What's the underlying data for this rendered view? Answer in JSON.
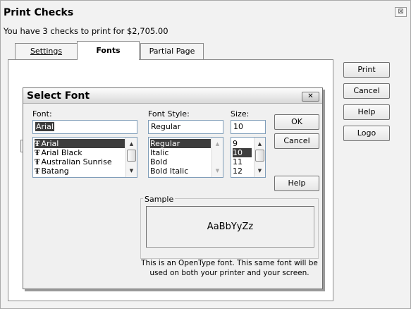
{
  "window": {
    "title": "Print Checks",
    "close_glyph": "⊠",
    "summary": "You have 3 checks to print for $2,705.00"
  },
  "tabs": [
    {
      "label": "Settings"
    },
    {
      "label": "Fonts"
    },
    {
      "label": "Partial Page"
    }
  ],
  "side_buttons": {
    "print": "Print",
    "cancel": "Cancel",
    "help": "Help",
    "logo": "Logo"
  },
  "select_font": {
    "title": "Select Font",
    "close_glyph": "✕",
    "font": {
      "label": "Font:",
      "value": "Arial",
      "items": [
        "Arial",
        "Arial Black",
        "Australian Sunrise",
        "Batang"
      ],
      "selected": "Arial",
      "type_glyph": "Ŧ"
    },
    "style": {
      "label": "Font Style:",
      "value": "Regular",
      "items": [
        "Regular",
        "Italic",
        "Bold",
        "Bold Italic"
      ],
      "selected": "Regular"
    },
    "size": {
      "label": "Size:",
      "value": "10",
      "items": [
        "9",
        "10",
        "11",
        "12"
      ],
      "selected": "10"
    },
    "buttons": {
      "ok": "OK",
      "cancel": "Cancel",
      "help": "Help"
    },
    "sample": {
      "label": "Sample",
      "text": "AaBbYyZz"
    },
    "note_line1": "This is an OpenType font. This same font will be",
    "note_line2": "used on both your printer and your screen."
  },
  "colors": {
    "selection": "#3d3d3d",
    "field_border": "#7f9db9",
    "window_bg": "#f2f2f2"
  }
}
